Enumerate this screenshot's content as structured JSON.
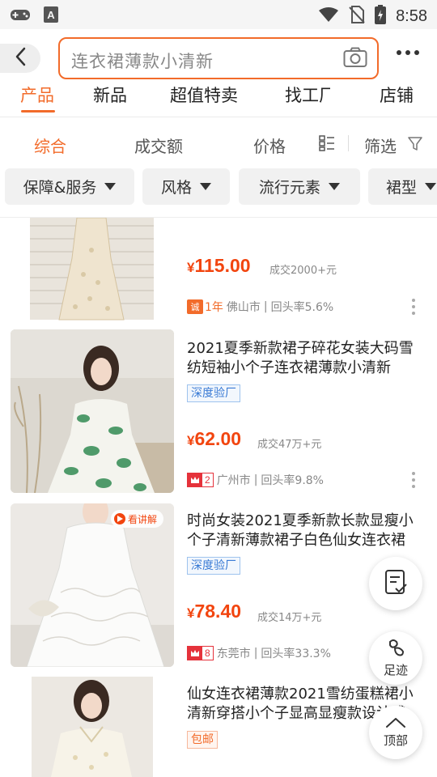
{
  "status_bar": {
    "time": "8:58"
  },
  "search": {
    "query": "连衣裙薄款小清新"
  },
  "tabs": [
    {
      "label": "产品",
      "active": true
    },
    {
      "label": "新品",
      "active": false
    },
    {
      "label": "超值特卖",
      "active": false
    },
    {
      "label": "找工厂",
      "active": false
    },
    {
      "label": "店铺",
      "active": false
    }
  ],
  "sort": {
    "comprehensive": "综合",
    "volume": "成交额",
    "price": "价格",
    "filter": "筛选"
  },
  "chips": [
    "保障&服务",
    "风格",
    "流行元素",
    "裙型"
  ],
  "products": [
    {
      "title": "",
      "price_currency": "¥",
      "price": "115.00",
      "sold": "成交2000+元",
      "badge_number": "1年",
      "city": "佛山市",
      "repurchase": "回头率5.6%"
    },
    {
      "title": "2021夏季新款裙子碎花女装大码雪纺短袖小个子连衣裙薄款小清新",
      "tag": "深度验厂",
      "price_currency": "¥",
      "price": "62.00",
      "sold": "成交47万+元",
      "badge_number": "2",
      "city": "广州市",
      "repurchase": "回头率9.8%"
    },
    {
      "title": "时尚女装2021夏季新款长款显瘦小个子清新薄款裙子白色仙女连衣裙",
      "tag": "深度验厂",
      "live_label": "看讲解",
      "price_currency": "¥",
      "price": "78.40",
      "sold": "成交14万+元",
      "badge_number": "8",
      "city": "东莞市",
      "repurchase": "回头率33.3%"
    },
    {
      "title": "仙女连衣裙薄款2021雪纺蛋糕裙小清新穿搭小个子显高显瘦款设计感",
      "tag": "包邮"
    }
  ],
  "fabs": {
    "footprint": "足迹",
    "top": "顶部"
  },
  "colors": {
    "accent": "#f26b2a",
    "price": "#f2450f",
    "tag_blue": "#3a7bd5",
    "badge_red": "#e5323b"
  },
  "icons": [
    "gamepad-icon",
    "text-a-icon",
    "wifi-icon",
    "no-sim-icon",
    "battery-icon",
    "back-icon",
    "camera-icon",
    "more-icon",
    "list-view-icon",
    "filter-icon",
    "clipboard-icon",
    "footprint-icon",
    "arrow-up-icon"
  ]
}
